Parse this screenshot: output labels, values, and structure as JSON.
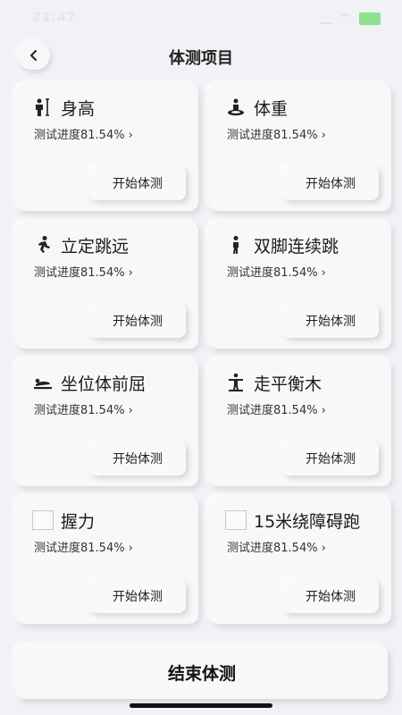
{
  "status": {
    "time": "21:47"
  },
  "header": {
    "title": "体测项目"
  },
  "cards": [
    {
      "title": "身高",
      "progress": "测试进度81.54%",
      "button": "开始体测",
      "icon": "height-icon"
    },
    {
      "title": "体重",
      "progress": "测试进度81.54%",
      "button": "开始体测",
      "icon": "weight-icon"
    },
    {
      "title": "立定跳远",
      "progress": "测试进度81.54%",
      "button": "开始体测",
      "icon": "long-jump-icon"
    },
    {
      "title": "双脚连续跳",
      "progress": "测试进度81.54%",
      "button": "开始体测",
      "icon": "jump-icon"
    },
    {
      "title": "坐位体前屈",
      "progress": "测试进度81.54%",
      "button": "开始体测",
      "icon": "sit-reach-icon"
    },
    {
      "title": "走平衡木",
      "progress": "测试进度81.54%",
      "button": "开始体测",
      "icon": "balance-beam-icon"
    },
    {
      "title": "握力",
      "progress": "测试进度81.54%",
      "button": "开始体测",
      "icon": "grip-placeholder-icon"
    },
    {
      "title": "15米绕障碍跑",
      "progress": "测试进度81.54%",
      "button": "开始体测",
      "icon": "obstacle-run-placeholder-icon"
    }
  ],
  "footer": {
    "end_label": "结束体测"
  }
}
